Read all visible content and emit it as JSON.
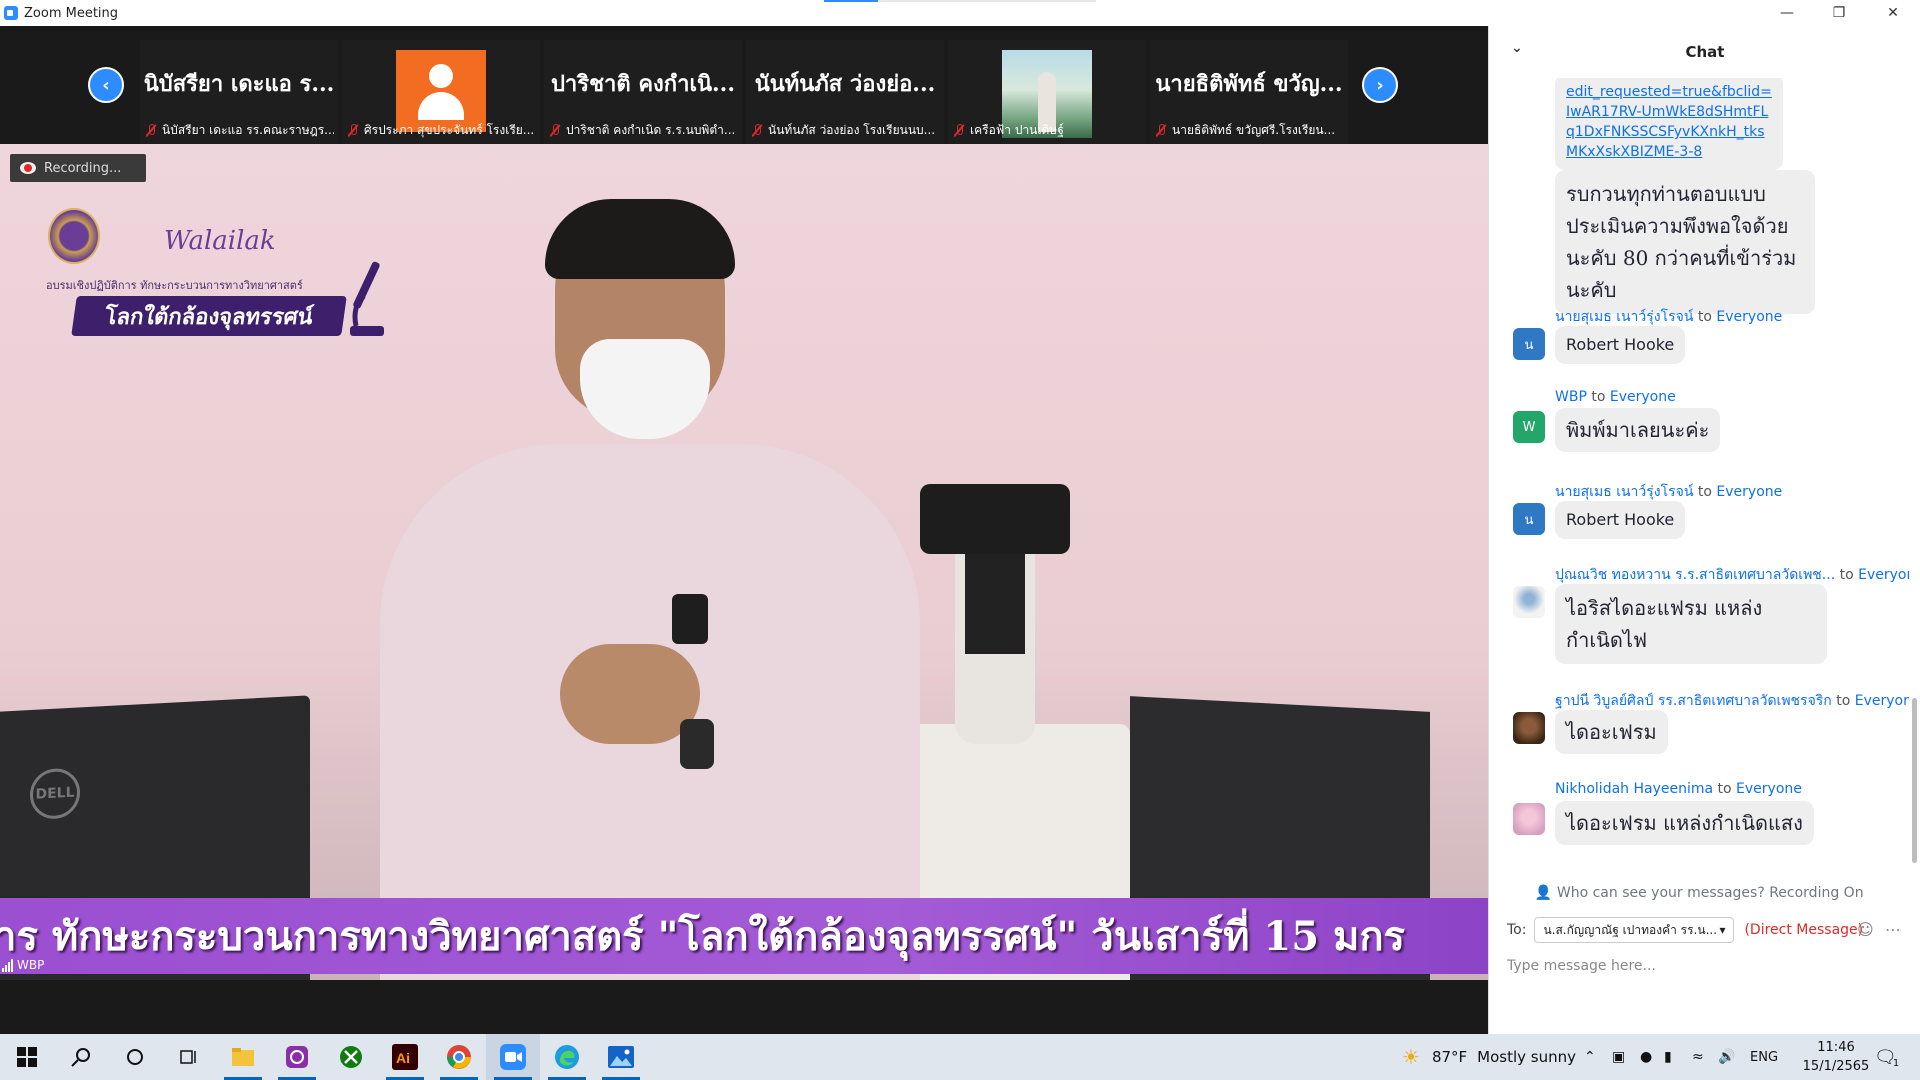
{
  "window": {
    "title": "Zoom Meeting",
    "progress_fraction": 0.2
  },
  "strip": {
    "tiles": [
      {
        "display_name": "นิบัสรียา เดะแอ ร...",
        "label": "นิบัสรียา เดะแอ รร.คณะราษฎร..."
      },
      {
        "display_name": "",
        "label": "ศิรประภา สุขประจันทร์ โรงเรีย..."
      },
      {
        "display_name": "ปาริชาติ คงกำเนิ...",
        "label": "ปาริชาติ คงกำเนิด ร.ร.นบพิตำ..."
      },
      {
        "display_name": "นันท์นภัส ว่องย่อ...",
        "label": "นันท์นภัส ว่องย่อง โรงเรียนนบ..."
      },
      {
        "display_name": "",
        "label": "เครือฟ้า ปานเดิษฐ์"
      },
      {
        "display_name": "นายธิติพัทธ์ ขวัญ...",
        "label": "นายธิติพัทธ์ ขวัญศรี.โรงเรียน..."
      }
    ]
  },
  "video": {
    "recording_label": "Recording...",
    "logo_text": "Walailak",
    "logo_sub": "อบรมเชิงปฏิบัติการ ทักษะกระบวนการทางวิทยาศาสตร์",
    "logo_banner": "โลกใต้กล้องจุลทรรศน์",
    "ticker": "าร ทักษะกระบวนการทางวิทยาศาสตร์ \"โลกใต้กล้องจุลทรรศน์\"  วันเสาร์ที่ 15 มกร",
    "speaker_label": "WBP",
    "monitor_brand": "DELL"
  },
  "chat": {
    "title": "Chat",
    "messages": {
      "m1": {
        "link": "edit_requested=true&fbclid=IwAR17RV-UmWkE8dSHmtFLq1DxFNKSSCSFyvKXnkH_tksMKxXskXBIZME-3-8"
      },
      "m2": {
        "text": "รบกวนทุกท่านตอบแบบประเมินความพึงพอใจด้วยนะคับ 80 กว่าคนที่เข้าร่วมนะคับ"
      },
      "m3": {
        "sender": "นายสุเมธ เนาว์รุ่งโรจน์",
        "to": "to",
        "recipient": "Everyone",
        "avatar": "น",
        "text": "Robert Hooke"
      },
      "m4": {
        "sender": "WBP",
        "to": "to",
        "recipient": "Everyone",
        "avatar": "W",
        "text": "พิมพ์มาเลยนะค่ะ"
      },
      "m5": {
        "sender": "นายสุเมธ เนาว์รุ่งโรจน์",
        "to": "to",
        "recipient": "Everyone",
        "avatar": "น",
        "text": "Robert Hooke"
      },
      "m6": {
        "sender": "ปุณณวิช ทองหวาน ร.ร.สาธิตเทศบาลวัดเพช...",
        "to": "to",
        "recipient": "Everyone",
        "text": "ไอริสไดอะแฟรม แหล่งกำเนิดไฟ"
      },
      "m7": {
        "sender": "ฐาปนี วิบูลย์ศิลป์ รร.สาธิตเทศบาลวัดเพชรจริก",
        "to": "to",
        "recipient": "Everyone",
        "text": "ไดอะเฟรม"
      },
      "m8": {
        "sender": "Nikholidah Hayeenima",
        "to": "to",
        "recipient": "Everyone",
        "text": "ไดอะเฟรม แหล่งกำเนิดแสง"
      }
    },
    "who_can_see": "Who can see your messages? Recording On",
    "to_label": "To:",
    "to_value": "น.ส.กัญญาณัฐ เปาทองคำ รร.น...",
    "direct_message": "(Direct Message)",
    "input_placeholder": "Type message here..."
  },
  "taskbar": {
    "weather_temp": "87°F",
    "weather_text": "Mostly sunny",
    "language": "ENG",
    "time": "11:46",
    "date": "15/1/2565",
    "notification_count": "1",
    "apps": [
      "start-icon",
      "search-icon",
      "cortana-icon",
      "task-view-icon",
      "file-explorer-icon",
      "app-icon",
      "xbox-icon",
      "illustrator-icon",
      "chrome-icon",
      "zoom-icon",
      "edge-icon",
      "photos-icon"
    ]
  },
  "colors": {
    "zoom_blue": "#2d8cff",
    "link_blue": "#0e71eb",
    "ticker_purple": "#9b4fd1",
    "muted_red": "#e02828"
  }
}
